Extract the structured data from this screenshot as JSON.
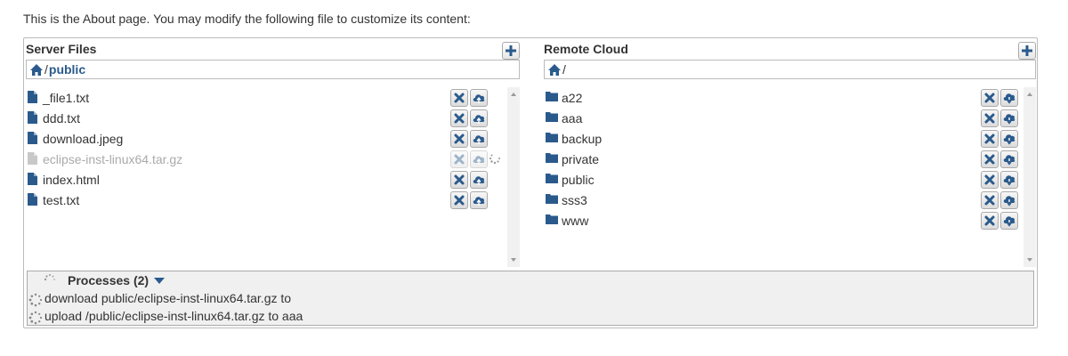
{
  "intro_text": "This is the About page. You may modify the following file to customize its content:",
  "server_panel": {
    "title": "Server Files",
    "path_sep": "/",
    "path_crumb": "public",
    "files": [
      {
        "name": "_file1.txt",
        "disabled": false
      },
      {
        "name": "ddd.txt",
        "disabled": false
      },
      {
        "name": "download.jpeg",
        "disabled": false
      },
      {
        "name": "eclipse-inst-linux64.tar.gz",
        "disabled": true
      },
      {
        "name": "index.html",
        "disabled": false
      },
      {
        "name": "test.txt",
        "disabled": false
      }
    ]
  },
  "cloud_panel": {
    "title": "Remote Cloud",
    "path_sep": "/",
    "folders": [
      "a22",
      "aaa",
      "backup",
      "private",
      "public",
      "sss3",
      "www"
    ]
  },
  "processes": {
    "header": "Processes (2)",
    "items": [
      "download public/eclipse-inst-linux64.tar.gz to",
      "upload /public/eclipse-inst-linux64.tar.gz to aaa"
    ]
  },
  "icons": {
    "add": "plus-icon",
    "home": "home-icon",
    "file": "file-icon",
    "folder": "folder-icon",
    "delete": "close-icon",
    "upload": "cloud-upload-icon",
    "download": "cloud-download-icon",
    "spinner": "spinner-icon"
  },
  "colors": {
    "accent": "#2a5a8c",
    "disabled_text": "#aaaaaa"
  }
}
